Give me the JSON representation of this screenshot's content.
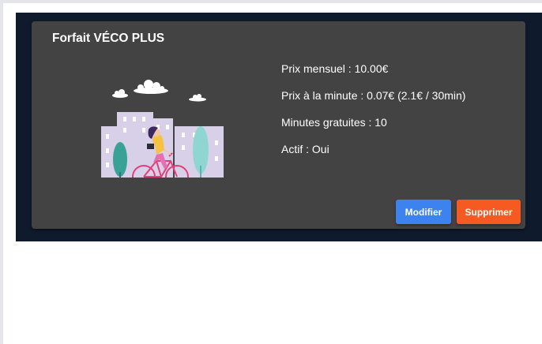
{
  "plan": {
    "title": "Forfait VÉCO PLUS",
    "monthly_price": "Prix mensuel : 10.00€",
    "minute_price": "Prix à la minute : 0.07€ (2.1€ / 30min)",
    "free_minutes": "Minutes gratuites : 10",
    "active": "Actif : Oui",
    "illustration": "woman-cycling-in-city-illustration"
  },
  "actions": {
    "edit_label": "Modifier",
    "delete_label": "Supprimer"
  },
  "colors": {
    "page_background": "#ffffff",
    "panel_background": "#0f1b2d",
    "card_background": "#434343",
    "edit_button": "#3d83f0",
    "delete_button": "#f55a22"
  }
}
